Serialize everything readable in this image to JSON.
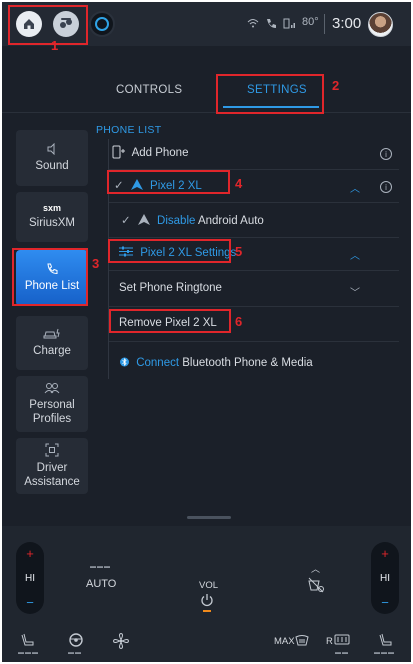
{
  "status_bar": {
    "icons": [
      "home-icon",
      "apps-icon",
      "alexa-icon",
      "wifi-icon",
      "phone-signal-icon",
      "cellular-signal-icon"
    ],
    "temperature": "80°",
    "time": "3:00"
  },
  "tabs": [
    {
      "label": "CONTROLS",
      "active": false
    },
    {
      "label": "SETTINGS",
      "active": true
    }
  ],
  "sidebar": {
    "items": [
      {
        "label": "Sound",
        "icon": "speaker-icon",
        "active": false
      },
      {
        "label": "SiriusXM",
        "icon": "sxm-logo",
        "icon_text": "sxm",
        "active": false
      },
      {
        "label": "Phone List",
        "icon": "phone-icon",
        "active": true
      },
      {
        "label": "Charge",
        "icon": "charge-icon",
        "active": false
      },
      {
        "label": "Personal Profiles",
        "icon": "profiles-icon",
        "active": false
      },
      {
        "label": "Driver Assistance",
        "icon": "driver-assist-icon",
        "active": false
      }
    ]
  },
  "phone_list": {
    "section_label": "PHONE LIST",
    "add_phone": "Add Phone",
    "device_name": "Pixel 2 XL",
    "android_auto_action": "Disable",
    "android_auto_label": "Android Auto",
    "device_settings": "Pixel 2 XL Settings",
    "ringtone": "Set Phone Ringtone",
    "remove": "Remove Pixel 2 XL",
    "connect_action": "Connect",
    "connect_label": "Bluetooth Phone & Media"
  },
  "annotations": [
    {
      "label": "1",
      "target": "home-button"
    },
    {
      "label": "2",
      "target": "settings-tab"
    },
    {
      "label": "3",
      "target": "phone-list-nav"
    },
    {
      "label": "4",
      "target": "pixel-device-row"
    },
    {
      "label": "5",
      "target": "pixel-settings-row"
    },
    {
      "label": "6",
      "target": "remove-device-row"
    }
  ],
  "climate": {
    "left_temp": "HI",
    "right_temp": "HI",
    "fan_mode": "AUTO",
    "volume_label": "VOL",
    "max_defrost": "MAX",
    "rear_defrost": "R"
  },
  "colors": {
    "accent": "#2f9ae6",
    "active_nav": "#1f74dc",
    "annotation": "#e0262b",
    "background": "#1b2029"
  }
}
